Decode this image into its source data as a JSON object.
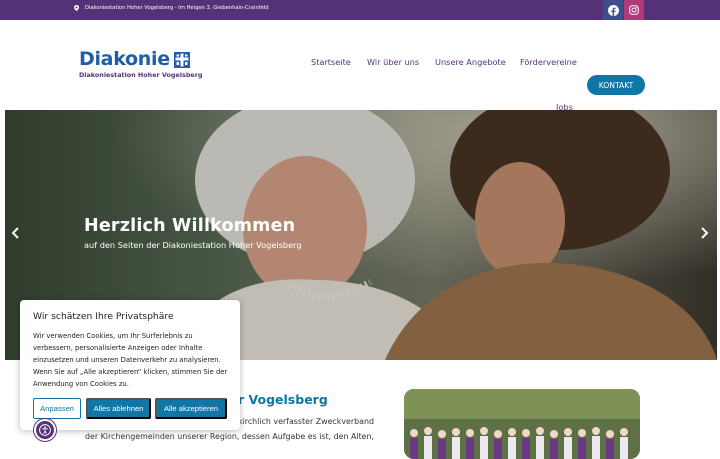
{
  "topbar": {
    "address": "Diakoniestation Hoher Vogelsberg - Im Heigen 3, Grebenhain-Crainfeld",
    "icons": [
      "map-pin-icon",
      "facebook-icon",
      "instagram-icon"
    ],
    "colors": {
      "bar": "#553278",
      "facebook": "#3c4f8a",
      "instagram": "#b33a7a"
    }
  },
  "logo": {
    "wordmark": "Diakonie",
    "subtitle": "Diakoniestation Hoher Vogelsberg"
  },
  "nav": {
    "items": [
      "Startseite",
      "Wir über uns",
      "Unsere Angebote",
      "Fördervereine",
      "Jobs"
    ],
    "kontakt_label": "KONTAKT"
  },
  "hero": {
    "title": "Herzlich Willkommen",
    "subtitle": "auf den Seiten der Diakoniestation Hoher Vogelsberg",
    "prev_arrow": "‹",
    "next_arrow": "›"
  },
  "intro": {
    "title_visible": "r Vogelsberg",
    "line1": "kirchlich verfasster Zweckverband",
    "line2": "der Kirchengemeinden unserer Region, dessen Aufgabe es ist, den Alten,"
  },
  "cookie": {
    "title": "Wir schätzen Ihre Privatsphäre",
    "text": "Wir verwenden Cookies, um Ihr Surferlebnis zu verbessern, personalisierte Anzeigen oder Inhalte einzusetzen und unseren Datenverkehr zu analysieren. Wenn Sie auf „Alle akzeptieren“ klicken, stimmen Sie der Anwendung von Cookies zu.",
    "btn_customize": "Anpassen",
    "btn_reject": "Alles ablehnen",
    "btn_accept": "Alle akzeptieren"
  },
  "accent_colors": {
    "purple": "#553278",
    "blue": "#0f76a6",
    "logo_blue": "#1f5ea8"
  }
}
